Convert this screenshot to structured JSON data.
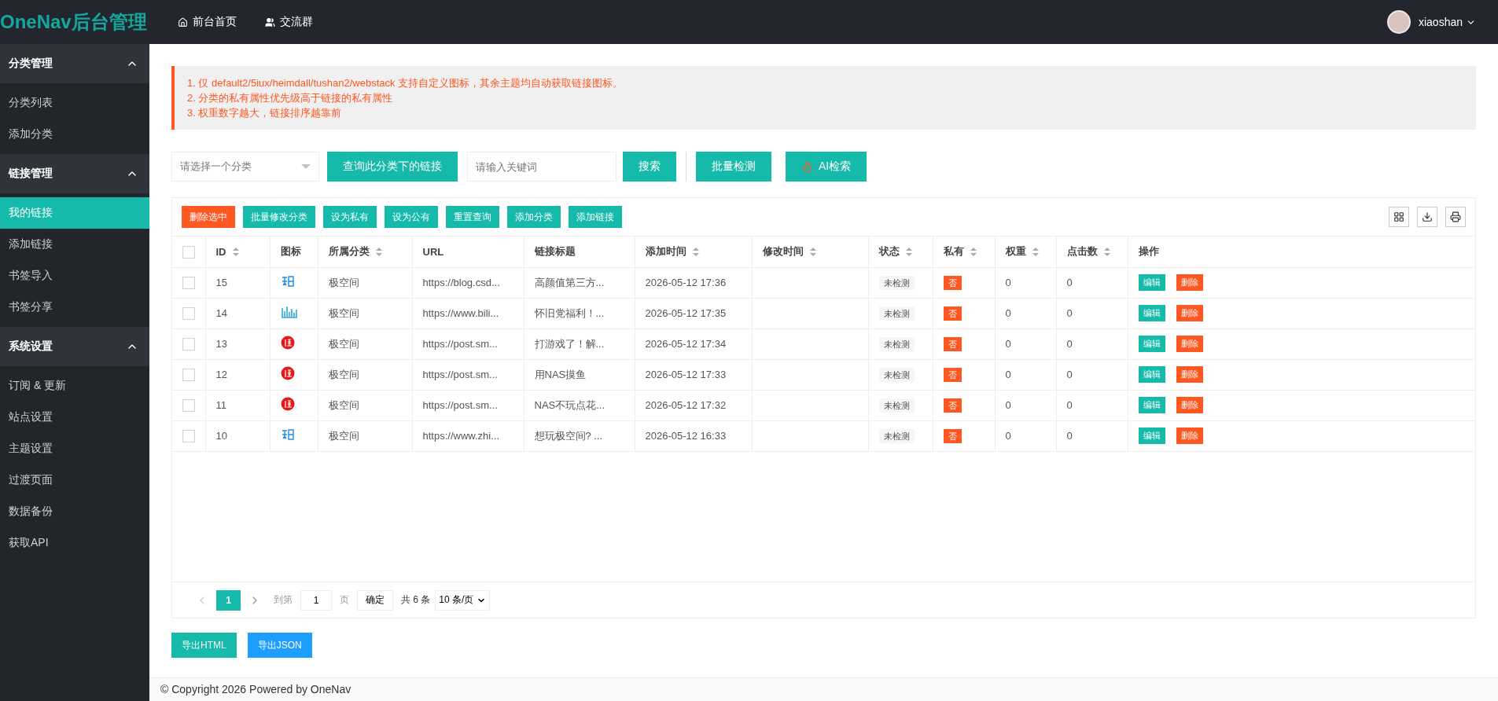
{
  "header": {
    "logo": "OneNav后台管理",
    "nav": [
      {
        "label": "前台首页",
        "kind": "home"
      },
      {
        "label": "交流群",
        "kind": "users"
      }
    ],
    "user": "xiaoshan"
  },
  "sidebar": [
    {
      "title": "分类管理",
      "expanded": true,
      "items": [
        {
          "label": "分类列表",
          "selected": false
        },
        {
          "label": "添加分类",
          "selected": false
        }
      ]
    },
    {
      "title": "链接管理",
      "expanded": true,
      "items": [
        {
          "label": "我的链接",
          "selected": true
        },
        {
          "label": "添加链接",
          "selected": false
        },
        {
          "label": "书签导入",
          "selected": false
        },
        {
          "label": "书签分享",
          "selected": false
        }
      ]
    },
    {
      "title": "系统设置",
      "expanded": true,
      "items": [
        {
          "label": "订阅 & 更新",
          "selected": false
        },
        {
          "label": "站点设置",
          "selected": false
        },
        {
          "label": "主题设置",
          "selected": false
        },
        {
          "label": "过渡页面",
          "selected": false
        },
        {
          "label": "数据备份",
          "selected": false
        },
        {
          "label": "获取API",
          "selected": false
        }
      ]
    }
  ],
  "notice": [
    "1. 仅 default2/5iux/heimdall/tushan2/webstack 支持自定义图标，其余主题均自动获取链接图标。",
    "2. 分类的私有属性优先级高于链接的私有属性",
    "3. 权重数字越大，链接排序越靠前"
  ],
  "filters": {
    "category_placeholder": "请选择一个分类",
    "query_button": "查询此分类下的链接",
    "keyword_placeholder": "请输入关键词",
    "search_button": "搜索",
    "check_button": "批量检测",
    "ai_button": "AI检索"
  },
  "toolbar": [
    {
      "label": "删除选中",
      "kind": "danger"
    },
    {
      "label": "批量修改分类",
      "kind": "normal"
    },
    {
      "label": "设为私有",
      "kind": "normal"
    },
    {
      "label": "设为公有",
      "kind": "normal"
    },
    {
      "label": "重置查询",
      "kind": "normal"
    },
    {
      "label": "添加分类",
      "kind": "normal"
    },
    {
      "label": "添加链接",
      "kind": "normal"
    }
  ],
  "table": {
    "all_checked": false,
    "columns": [
      {
        "label": "ID",
        "sortable": true
      },
      {
        "label": "图标",
        "sortable": false
      },
      {
        "label": "所属分类",
        "sortable": true
      },
      {
        "label": "URL",
        "sortable": false
      },
      {
        "label": "链接标题",
        "sortable": false
      },
      {
        "label": "添加时间",
        "sortable": true
      },
      {
        "label": "修改时间",
        "sortable": true
      },
      {
        "label": "状态",
        "sortable": true
      },
      {
        "label": "私有",
        "sortable": true
      },
      {
        "label": "权重",
        "sortable": true
      },
      {
        "label": "点击数",
        "sortable": true
      },
      {
        "label": "操作",
        "sortable": false
      }
    ],
    "rows": [
      {
        "checked": false,
        "id": "15",
        "kind": "script",
        "category": "极空间",
        "url": "https://blog.csd...",
        "title": "高颜值第三方...",
        "added": "2026-05-12 17:36",
        "modified": "",
        "status": "未检测",
        "private": "否",
        "weight": "0",
        "clicks": "0",
        "edit": "编辑",
        "delete": "删除"
      },
      {
        "checked": false,
        "id": "14",
        "kind": "bars",
        "category": "极空间",
        "url": "https://www.bili...",
        "title": "怀旧党福利！...",
        "added": "2026-05-12 17:35",
        "modified": "",
        "status": "未检测",
        "private": "否",
        "weight": "0",
        "clicks": "0",
        "edit": "编辑",
        "delete": "删除"
      },
      {
        "checked": false,
        "id": "13",
        "kind": "seal",
        "category": "极空间",
        "url": "https://post.sm...",
        "title": "打游戏了！解...",
        "added": "2026-05-12 17:34",
        "modified": "",
        "status": "未检测",
        "private": "否",
        "weight": "0",
        "clicks": "0",
        "edit": "编辑",
        "delete": "删除"
      },
      {
        "checked": false,
        "id": "12",
        "kind": "seal",
        "category": "极空间",
        "url": "https://post.sm...",
        "title": "用NAS摸鱼",
        "added": "2026-05-12 17:33",
        "modified": "",
        "status": "未检测",
        "private": "否",
        "weight": "0",
        "clicks": "0",
        "edit": "编辑",
        "delete": "删除"
      },
      {
        "checked": false,
        "id": "11",
        "kind": "seal",
        "category": "极空间",
        "url": "https://post.sm...",
        "title": "NAS不玩点花...",
        "added": "2026-05-12 17:32",
        "modified": "",
        "status": "未检测",
        "private": "否",
        "weight": "0",
        "clicks": "0",
        "edit": "编辑",
        "delete": "删除"
      },
      {
        "checked": false,
        "id": "10",
        "kind": "script",
        "category": "极空间",
        "url": "https://www.zhi...",
        "title": "想玩极空间? ...",
        "added": "2026-05-12 16:33",
        "modified": "",
        "status": "未检测",
        "private": "否",
        "weight": "0",
        "clicks": "0",
        "edit": "编辑",
        "delete": "删除"
      }
    ]
  },
  "pagination": {
    "pages": [
      {
        "label": "1",
        "selected": true
      }
    ],
    "prev_disabled": true,
    "goto_label": "到第",
    "goto_value": "1",
    "page_unit": "页",
    "confirm": "确定",
    "total": "共 6 条",
    "per_page": "10 条/页"
  },
  "export": [
    {
      "label": "导出HTML",
      "kind": "green"
    },
    {
      "label": "导出JSON",
      "kind": "blue"
    }
  ],
  "footer": "© Copyright 2026 Powered by OneNav"
}
